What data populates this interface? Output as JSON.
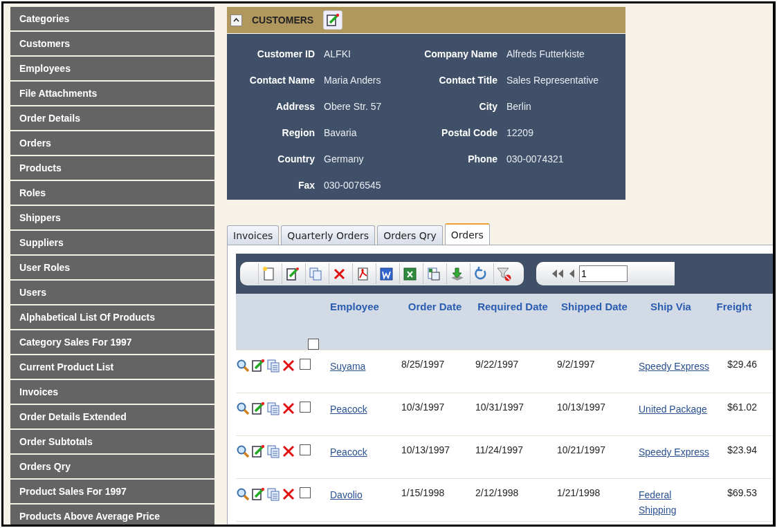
{
  "sidebar": {
    "items": [
      {
        "label": "Categories"
      },
      {
        "label": "Customers"
      },
      {
        "label": "Employees"
      },
      {
        "label": "File Attachments"
      },
      {
        "label": "Order Details"
      },
      {
        "label": "Orders"
      },
      {
        "label": "Products"
      },
      {
        "label": "Roles"
      },
      {
        "label": "Shippers"
      },
      {
        "label": "Suppliers"
      },
      {
        "label": "User Roles"
      },
      {
        "label": "Users"
      },
      {
        "label": "Alphabetical List Of Products"
      },
      {
        "label": "Category Sales For 1997"
      },
      {
        "label": "Current Product List"
      },
      {
        "label": "Invoices"
      },
      {
        "label": "Order Details Extended"
      },
      {
        "label": "Order Subtotals"
      },
      {
        "label": "Orders Qry"
      },
      {
        "label": "Product Sales For 1997"
      },
      {
        "label": "Products Above Average Price"
      }
    ]
  },
  "customer_panel": {
    "title": "CUSTOMERS",
    "fields": [
      {
        "label": "Customer ID",
        "value": "ALFKI"
      },
      {
        "label": "Company Name",
        "value": "Alfreds Futterkiste"
      },
      {
        "label": "Contact Name",
        "value": "Maria Anders"
      },
      {
        "label": "Contact Title",
        "value": "Sales Representative"
      },
      {
        "label": "Address",
        "value": "Obere Str. 57"
      },
      {
        "label": "City",
        "value": "Berlin"
      },
      {
        "label": "Region",
        "value": "Bavaria"
      },
      {
        "label": "Postal Code",
        "value": "12209"
      },
      {
        "label": "Country",
        "value": "Germany"
      },
      {
        "label": "Phone",
        "value": "030-0074321"
      },
      {
        "label": "Fax",
        "value": "030-0076545"
      }
    ]
  },
  "tabs": [
    {
      "label": "Invoices",
      "selected": false
    },
    {
      "label": "Quarterly Orders",
      "selected": false
    },
    {
      "label": "Orders Qry",
      "selected": false
    },
    {
      "label": "Orders",
      "selected": true
    }
  ],
  "pager": {
    "page": "1"
  },
  "table": {
    "select_all_checked": false,
    "columns": [
      "Employee",
      "Order Date",
      "Required Date",
      "Shipped Date",
      "Ship Via",
      "Freight"
    ],
    "rows": [
      {
        "employee": "Suyama",
        "order_date": "8/25/1997",
        "required_date": "9/22/1997",
        "shipped_date": "9/2/1997",
        "ship_via": "Speedy Express",
        "freight": "$29.46",
        "checked": false
      },
      {
        "employee": "Peacock",
        "order_date": "10/3/1997",
        "required_date": "10/31/1997",
        "shipped_date": "10/13/1997",
        "ship_via": "United Package",
        "freight": "$61.02",
        "checked": false
      },
      {
        "employee": "Peacock",
        "order_date": "10/13/1997",
        "required_date": "11/24/1997",
        "shipped_date": "10/21/1997",
        "ship_via": "Speedy Express",
        "freight": "$23.94",
        "checked": false
      },
      {
        "employee": "Davolio",
        "order_date": "1/15/1998",
        "required_date": "2/12/1998",
        "shipped_date": "1/21/1998",
        "ship_via": "Federal Shipping",
        "freight": "$69.53",
        "checked": false
      }
    ]
  }
}
